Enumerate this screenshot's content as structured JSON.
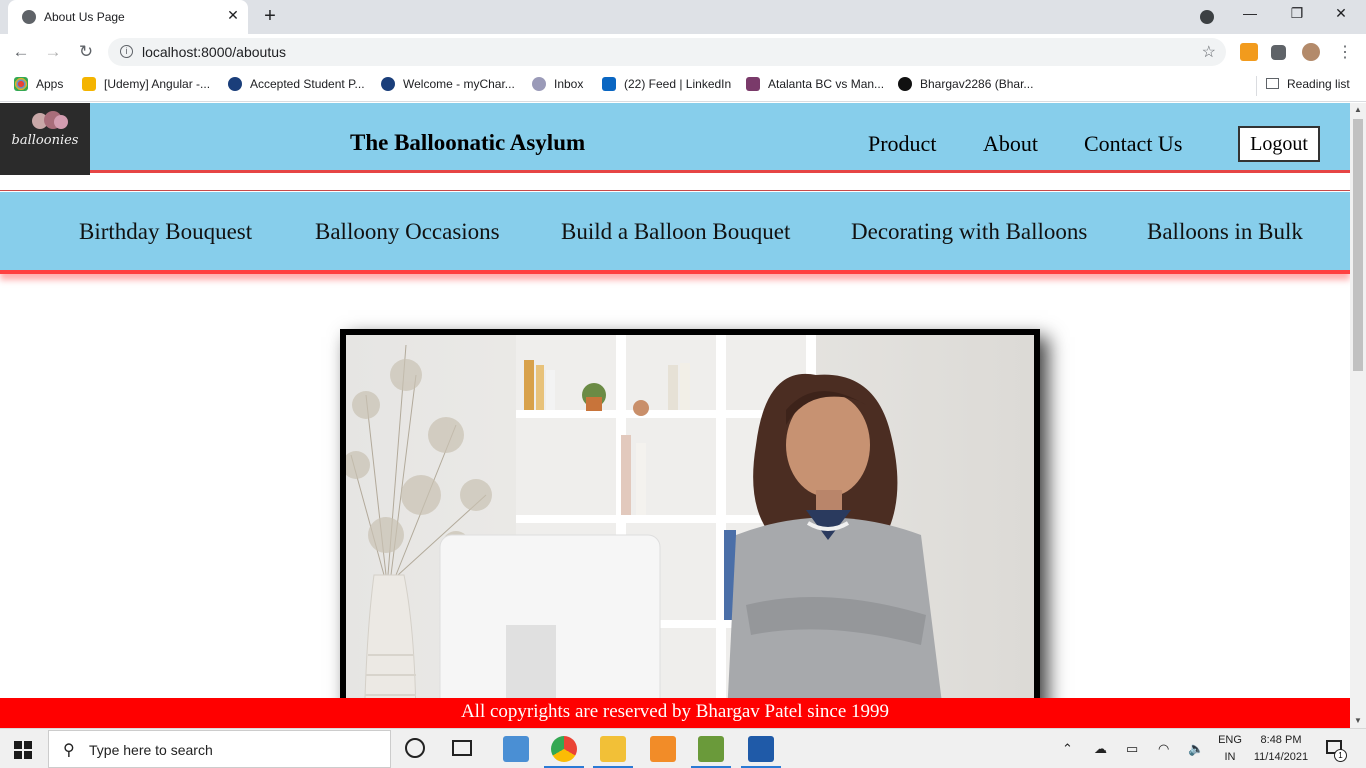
{
  "browser": {
    "tab_title": "About Us Page",
    "tab_close": "✕",
    "new_tab": "+",
    "url": "localhost:8000/aboutus",
    "bookmarks": [
      {
        "label": "Apps",
        "icon": "apps-grid-icon",
        "color": "#ea4335"
      },
      {
        "label": "[Udemy] Angular -...",
        "icon": "udemy-icon",
        "color": "#f4b400"
      },
      {
        "label": "Accepted Student P...",
        "icon": "school-seal-icon",
        "color": "#1a3e7a"
      },
      {
        "label": "Welcome - myChar...",
        "icon": "school-seal-icon",
        "color": "#1a3e7a"
      },
      {
        "label": "Inbox",
        "icon": "mail-icon",
        "color": "#6b6b9a"
      },
      {
        "label": "(22) Feed | LinkedIn",
        "icon": "linkedin-icon",
        "color": "#0a66c2"
      },
      {
        "label": "Atalanta BC vs Man...",
        "icon": "soccer-icon",
        "color": "#7a3a6a"
      },
      {
        "label": "Bhargav2286 (Bhar...",
        "icon": "github-icon",
        "color": "#111111"
      }
    ],
    "reading_list": "Reading list"
  },
  "site": {
    "title": "The Balloonatic Asylum",
    "logo_text": "balloonies",
    "nav": [
      "Product",
      "About",
      "Contact Us"
    ],
    "logout": "Logout",
    "subnav": [
      "Birthday Bouquest",
      "Balloony Occasions",
      "Build a Balloon Bouquet",
      "Decorating with Balloons",
      "Balloons in Bulk"
    ],
    "footer": "All copyrights are reserved by Bhargav Patel since 1999",
    "colors": {
      "header_bg": "#87ceeb",
      "accent_red": "#ff0000"
    }
  },
  "taskbar": {
    "search_placeholder": "Type here to search",
    "lang_top": "ENG",
    "lang_bottom": "IN",
    "time": "8:48 PM",
    "date": "11/14/2021",
    "notification_count": "1"
  }
}
